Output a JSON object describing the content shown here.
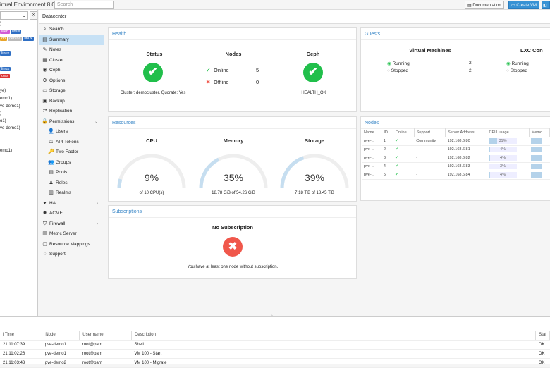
{
  "topbar": {
    "title": "irtual Environment 8.0.0",
    "search_placeholder": "Search",
    "documentation": "Documentation",
    "create_vm": "Create VM"
  },
  "left": {
    "tree": [
      {
        "text": ")",
        "tags": []
      },
      {
        "text": "",
        "tags": [
          {
            "t": "web",
            "c": "#d25cd6"
          },
          {
            "t": "linux",
            "c": "#2f6fc4"
          }
        ]
      },
      {
        "text": "",
        "tags": [
          {
            "t": "db",
            "c": "#e8a52a"
          },
          {
            "t": "centos",
            "c": "#bbb"
          },
          {
            "t": "linux",
            "c": "#2f6fc4"
          }
        ]
      },
      {
        "text": "",
        "tags": []
      },
      {
        "text": "",
        "tags": [
          {
            "t": "linux",
            "c": "#2f6fc4"
          }
        ]
      },
      {
        "text": "",
        "tags": []
      },
      {
        "text": "",
        "tags": [
          {
            "t": "linux",
            "c": "#2f6fc4"
          }
        ]
      },
      {
        "text": "",
        "tags": [
          {
            "t": "ows",
            "c": "#d33"
          }
        ]
      },
      {
        "text": "",
        "tags": []
      },
      {
        "text": "ye)",
        "tags": []
      },
      {
        "text": "emo1)",
        "tags": []
      },
      {
        "text": "ve-demo1)",
        "tags": []
      },
      {
        "text": ")",
        "tags": []
      },
      {
        "text": "o1)",
        "tags": []
      },
      {
        "text": "ve-demo1)",
        "tags": []
      },
      {
        "text": "",
        "tags": []
      },
      {
        "text": "",
        "tags": []
      },
      {
        "text": "emo1)",
        "tags": []
      }
    ]
  },
  "breadcrumb": "Datacenter",
  "nav": [
    {
      "label": "Search",
      "icon": "⌕",
      "level": 0
    },
    {
      "label": "Summary",
      "icon": "▤",
      "level": 0,
      "selected": true
    },
    {
      "label": "Notes",
      "icon": "✎",
      "level": 0
    },
    {
      "label": "Cluster",
      "icon": "▦",
      "level": 0
    },
    {
      "label": "Ceph",
      "icon": "◉",
      "level": 0
    },
    {
      "label": "Options",
      "icon": "⚙",
      "level": 0
    },
    {
      "label": "Storage",
      "icon": "▭",
      "level": 0
    },
    {
      "label": "Backup",
      "icon": "▣",
      "level": 0
    },
    {
      "label": "Replication",
      "icon": "⇄",
      "level": 0
    },
    {
      "label": "Permissions",
      "icon": "🔒",
      "level": 0,
      "expand": "⌄"
    },
    {
      "label": "Users",
      "icon": "👤",
      "level": 1
    },
    {
      "label": "API Tokens",
      "icon": "⚿",
      "level": 1
    },
    {
      "label": "Two Factor",
      "icon": "🔑",
      "level": 1
    },
    {
      "label": "Groups",
      "icon": "👥",
      "level": 1
    },
    {
      "label": "Pools",
      "icon": "▤",
      "level": 1
    },
    {
      "label": "Roles",
      "icon": "♟",
      "level": 1
    },
    {
      "label": "Realms",
      "icon": "▥",
      "level": 1
    },
    {
      "label": "HA",
      "icon": "♥",
      "level": 0,
      "expand": "›"
    },
    {
      "label": "ACME",
      "icon": "✹",
      "level": 0
    },
    {
      "label": "Firewall",
      "icon": "⛉",
      "level": 0,
      "expand": "›"
    },
    {
      "label": "Metric Server",
      "icon": "▥",
      "level": 0
    },
    {
      "label": "Resource Mappings",
      "icon": "▢",
      "level": 0
    },
    {
      "label": "Support",
      "icon": "◌",
      "level": 0
    }
  ],
  "health": {
    "title": "Health",
    "status_h": "Status",
    "nodes_h": "Nodes",
    "ceph_h": "Ceph",
    "cluster_text": "Cluster: democluster, Quorate: Yes",
    "online_label": "Online",
    "online_count": "5",
    "offline_label": "Offline",
    "offline_count": "0",
    "ceph_status": "HEALTH_OK",
    "status_ok": "✔",
    "ceph_ok": "✔",
    "online_icon": "✔",
    "offline_icon": "✖"
  },
  "guests": {
    "title": "Guests",
    "vm_h": "Virtual Machines",
    "lxc_h": "LXC Con",
    "running": "Running",
    "stopped": "Stopped",
    "vm_running": "2",
    "vm_stopped": "2",
    "lxc_running": "Running",
    "lxc_stopped": "Stopped"
  },
  "resources": {
    "title": "Resources",
    "cpu": {
      "h": "CPU",
      "pct": "9%",
      "value": 9,
      "sub": "of 10 CPU(s)"
    },
    "mem": {
      "h": "Memory",
      "pct": "35%",
      "value": 35,
      "sub": "18.78 GiB of 54.26 GiB"
    },
    "sto": {
      "h": "Storage",
      "pct": "39%",
      "value": 39,
      "sub": "7.18 TiB of 18.45 TiB"
    }
  },
  "subscriptions": {
    "title": "Subscriptions",
    "h": "No Subscription",
    "msg": "You have at least one node without subscription.",
    "icon": "✖"
  },
  "nodes": {
    "title": "Nodes",
    "cols": [
      "Name",
      "ID",
      "Online",
      "Support",
      "Server Address",
      "CPU usage",
      "Memo"
    ],
    "rows": [
      {
        "name": "pve-...",
        "id": "1",
        "online": "✔",
        "support": "Community",
        "addr": "192.168.6.80",
        "cpu": "31%",
        "cpuv": 31
      },
      {
        "name": "pve-...",
        "id": "2",
        "online": "✔",
        "support": "-",
        "addr": "192.168.6.81",
        "cpu": "4%",
        "cpuv": 4
      },
      {
        "name": "pve-...",
        "id": "3",
        "online": "✔",
        "support": "-",
        "addr": "192.168.6.82",
        "cpu": "4%",
        "cpuv": 4
      },
      {
        "name": "pve-...",
        "id": "4",
        "online": "✔",
        "support": "-",
        "addr": "192.168.6.83",
        "cpu": "3%",
        "cpuv": 3
      },
      {
        "name": "pve-...",
        "id": "5",
        "online": "✔",
        "support": "-",
        "addr": "192.168.6.84",
        "cpu": "4%",
        "cpuv": 4
      }
    ]
  },
  "tasks": {
    "cols": [
      "l Time",
      "Node",
      "User name",
      "Description",
      "Stat"
    ],
    "rows": [
      {
        "time": "21 11:07:39",
        "node": "pve-demo1",
        "user": "root@pam",
        "desc": "Shell",
        "status": "OK"
      },
      {
        "time": "21 11:02:26",
        "node": "pve-demo1",
        "user": "root@pam",
        "desc": "VM 100 - Start",
        "status": "OK"
      },
      {
        "time": "21 11:03:43",
        "node": "pve-demo2",
        "user": "root@pam",
        "desc": "VM 100 - Migrate",
        "status": "OK"
      }
    ]
  },
  "colors": {
    "ok": "#21bf4b",
    "err": "#f0574b",
    "accent": "#3892d4",
    "gauge": "#c6def0",
    "gauge_track": "#eeeeee"
  }
}
